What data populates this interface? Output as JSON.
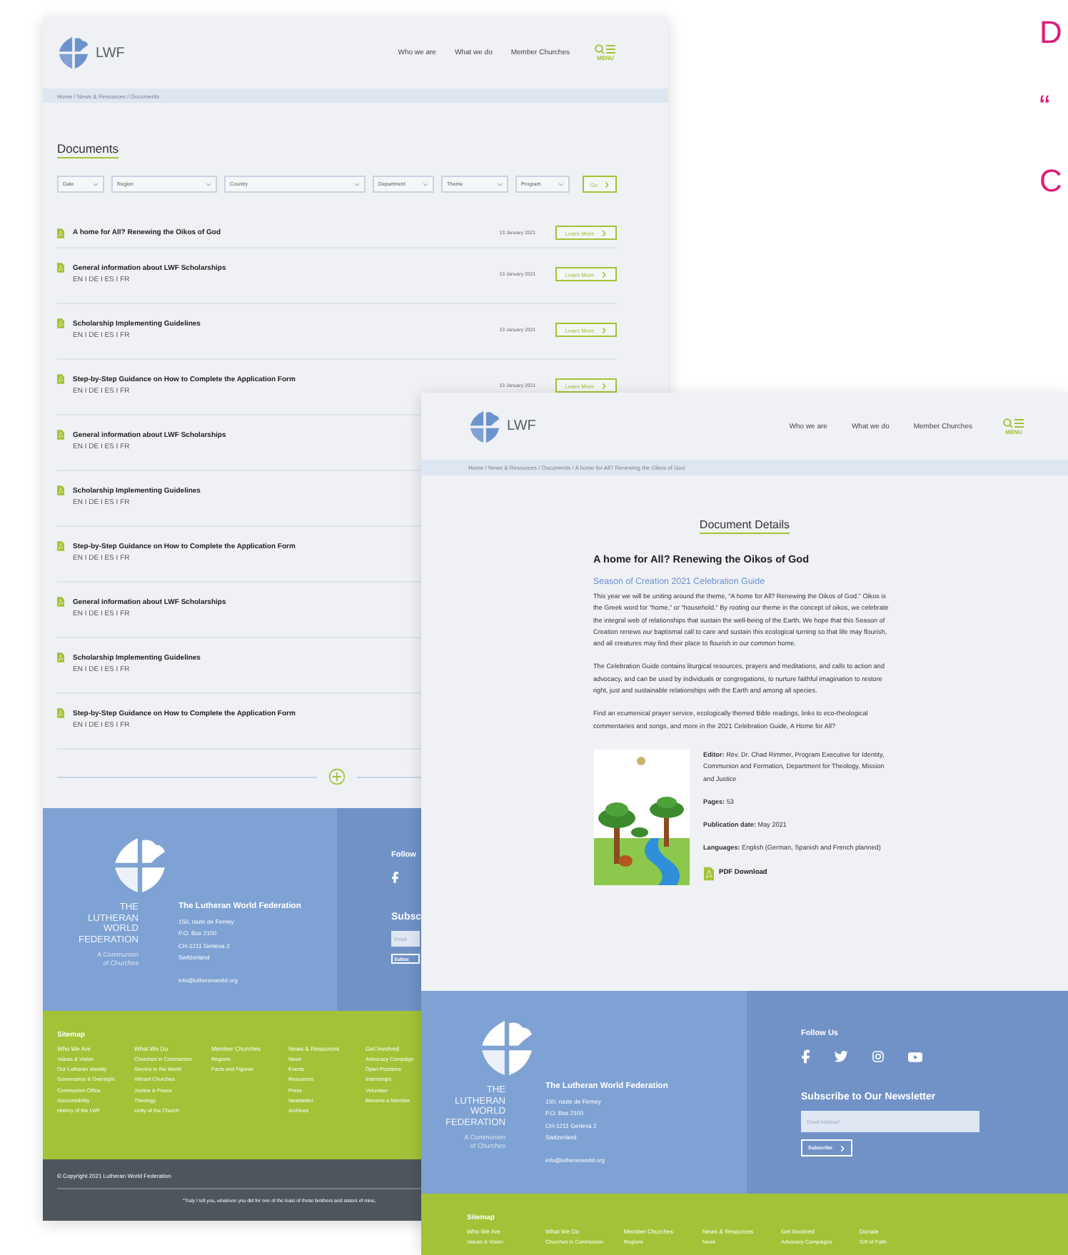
{
  "side_text": [
    "D",
    "“",
    "C"
  ],
  "back_page": {
    "header": {
      "logo_text": "LWF",
      "nav": [
        "Who we are",
        "What we do",
        "Member Churches"
      ],
      "menu_label": "MENU"
    },
    "breadcrumb": "Home / News & Resources / Documents",
    "heading": "Documents",
    "filters": [
      "Date",
      "Region",
      "Country",
      "Department",
      "Theme",
      "Program"
    ],
    "go_button": "Go",
    "documents": [
      {
        "title": "A home for All? Renewing the Oikos of God",
        "date": "13 January 2021",
        "button": "Learn More"
      },
      {
        "title": "General information about LWF Scholarships",
        "languages": "EN I DE I ES I FR",
        "date": "13 January 2021",
        "button": "Learn More"
      },
      {
        "title": "Scholarship Implementing Guidelines",
        "languages": "EN I DE I ES I FR",
        "date": "13 January 2021",
        "button": "Learn More"
      },
      {
        "title": "Step-by-Step Guidance on How to Complete the Application Form",
        "languages": "EN I DE I ES I FR",
        "date": "13 January 2021",
        "button": "Learn More"
      },
      {
        "title": "General information about LWF Scholarships",
        "languages": "EN I DE I ES I FR"
      },
      {
        "title": "Scholarship Implementing Guidelines",
        "languages": "EN I DE I ES I FR"
      },
      {
        "title": "Step-by-Step Guidance on How to Complete the Application Form",
        "languages": "EN I DE I ES I FR"
      },
      {
        "title": "General information about LWF Scholarships",
        "languages": "EN I DE I ES I FR"
      },
      {
        "title": "Scholarship Implementing Guidelines",
        "languages": "EN I DE I ES I FR"
      },
      {
        "title": "Step-by-Step Guidance on How to Complete the Application Form",
        "languages": "EN I DE I ES I FR"
      }
    ],
    "footer": {
      "org_mark": [
        "THE",
        "LUTHERAN",
        "WORLD",
        "FEDERATION"
      ],
      "tagline": [
        "A Communion",
        "of Churches"
      ],
      "org_name": "The Lutheran World Federation",
      "address": [
        "150, route de Ferney",
        "P.O. Box 2100",
        "CH-1211 Geneva 2",
        "Switzerland"
      ],
      "email": "info@lutheranworld.org",
      "follow_heading": "Follow",
      "subscribe_heading": "Subsc",
      "email_placeholder": "Email",
      "subscribe_button": "Subsc"
    },
    "sitemap": {
      "heading": "Sitemap",
      "columns": [
        {
          "title": "Who We Are",
          "links": [
            "Values & Vision",
            "Our Lutheran Identity",
            "Governance & Oversight",
            "Communion Office",
            "Accountability",
            "History of the LWF"
          ]
        },
        {
          "title": "What We Do",
          "links": [
            "Churches in Communion",
            "Service in the World",
            "Vibrant Churches",
            "Justice & Peace",
            "Theology",
            "Unity of the Church"
          ]
        },
        {
          "title": "Member Churches",
          "links": [
            "Regions",
            "Facts and Figures"
          ]
        },
        {
          "title": "News & Resources",
          "links": [
            "News",
            "Events",
            "Resources",
            "Press",
            "Newsletter",
            "Archives"
          ]
        },
        {
          "title": "Get Involved",
          "links": [
            "Advocacy Campaign",
            "Open Positions",
            "Internships",
            "Volunteer",
            "Become a Member"
          ]
        }
      ]
    },
    "copyright": "© Copyright 2021 Lutheran World Federation",
    "quote": "“Truly I tell you, whatever you did for one of the least of these brothers and sisters of mine,"
  },
  "front_page": {
    "header": {
      "logo_text": "LWF",
      "nav": [
        "Who we are",
        "What we do",
        "Member Churches"
      ],
      "menu_label": "MENU"
    },
    "breadcrumb": "Home / News & Resources / Documents / A home for All? Renewing the Oikos of God",
    "heading": "Document Details",
    "title": "A home for All? Renewing the Oikos of God",
    "subtitle": "Season of Creation 2021 Celebration Guide",
    "paragraphs": [
      "This year we will be uniting around the theme, “A home for All? Renewing the Oikos of God.” Oikos is the Greek word for “home,” or “household.” By rooting our theme in the concept of oikos, we celebrate the integral web of relationships that sustain the well-being of the Earth. We hope that this Season of Creation renews our baptismal call to care and sustain this ecological turning so that life may flourish, and all creatures may find their place to flourish in our common home.",
      "The Celebration Guide contains liturgical resources, prayers and meditations, and calls to action and advocacy, and can be used by individuals or congregations, to nurture faithful imagination to restore right, just and sustainable relationships with the Earth and among all species.",
      "Find an ecumenical prayer service, ecologically themed Bible readings, links to eco-theological commentaries and songs, and more in the 2021 Celebration Guide, A Home for All?"
    ],
    "details": [
      "**Editor:** Rev. Dr. Chad Rimmer, Program Executive for Identity, Communion and Formation, Department for Theology, Mission and Justice",
      "**Pages:** 53",
      "**Publication date:** May 2021",
      "**Languages:** English (German, Spanish and French planned)"
    ],
    "download": "PDF Download",
    "footer": {
      "org_mark": [
        "THE",
        "LUTHERAN",
        "WORLD",
        "FEDERATION"
      ],
      "tagline": [
        "A Communion",
        "of Churches"
      ],
      "org_name": "The Lutheran World Federation",
      "address": [
        "150, route de Ferney",
        "P.O. Box 2100",
        "CH-1211 Geneva 2",
        "Switzerland"
      ],
      "email": "info@lutheranworld.org",
      "follow_heading": "Follow Us",
      "subscribe_heading": "Subscribe to Our Newsletter",
      "email_placeholder": "Email Address*",
      "subscribe_button": "Subscribe"
    },
    "sitemap": {
      "heading": "Sitemap",
      "columns": [
        {
          "title": "Who We Are",
          "links": [
            "Values & Vision"
          ]
        },
        {
          "title": "What We Do",
          "links": [
            "Churches in Communion"
          ]
        },
        {
          "title": "Member Churches",
          "links": [
            "Regions"
          ]
        },
        {
          "title": "News & Resources",
          "links": [
            "News"
          ]
        },
        {
          "title": "Get Involved",
          "links": [
            "Advocacy Campaigns"
          ]
        },
        {
          "title": "Donate",
          "links": [
            "Gift of Faith"
          ]
        }
      ]
    }
  }
}
